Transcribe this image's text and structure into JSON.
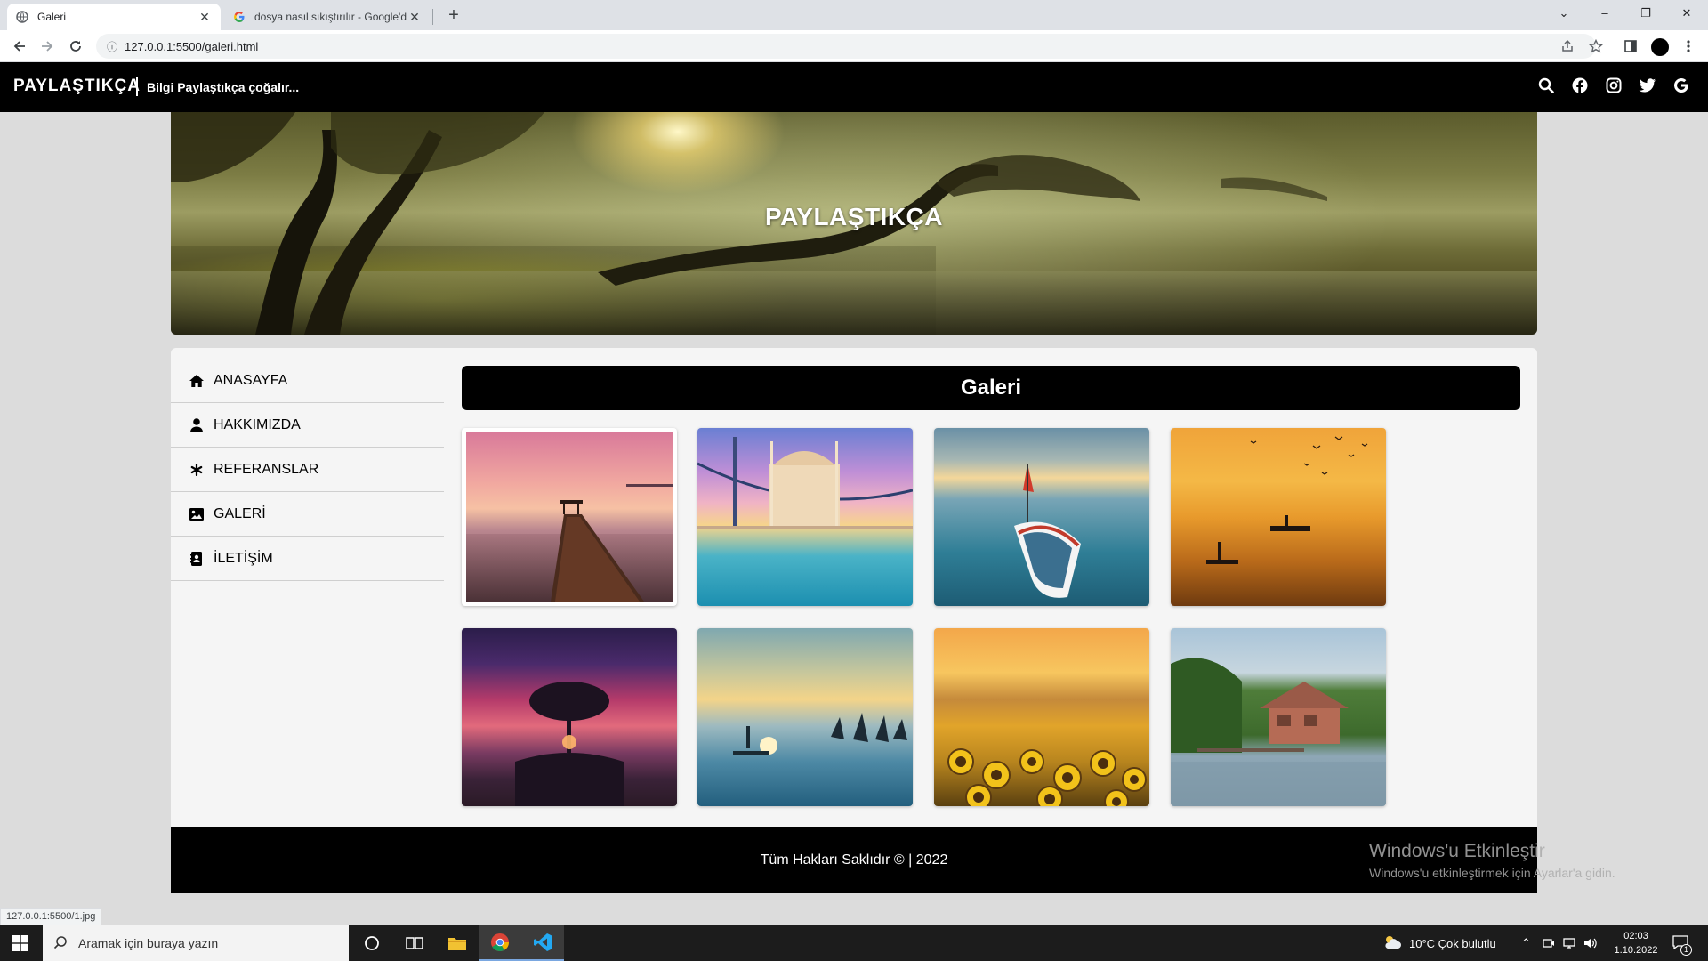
{
  "browser": {
    "tabs": [
      {
        "title": "Galeri",
        "active": true
      },
      {
        "title": "dosya nasıl sıkıştırılır - Google'da",
        "active": false
      }
    ],
    "url": "127.0.0.1:5500/galeri.html",
    "status_url": "127.0.0.1:5500/1.jpg"
  },
  "site": {
    "brand": "PAYLAŞTIKÇA",
    "tagline": "Bilgi Paylaştıkça çoğalır...",
    "hero_title": "PAYLAŞTIKÇA",
    "social_icons": [
      "search-icon",
      "facebook-icon",
      "instagram-icon",
      "twitter-icon",
      "google-icon"
    ],
    "menu": [
      {
        "label": "ANASAYFA",
        "icon": "home-icon"
      },
      {
        "label": "HAKKIMIZDA",
        "icon": "user-icon"
      },
      {
        "label": "REFERANSLAR",
        "icon": "asterisk-icon"
      },
      {
        "label": "GALERİ",
        "icon": "image-icon"
      },
      {
        "label": "İLETİŞİM",
        "icon": "contact-card-icon"
      }
    ],
    "gallery_title": "Galeri",
    "gallery_images": [
      "pier-sunset-image",
      "mosque-bridge-image",
      "boat-sea-image",
      "fisherman-sunset-image",
      "lone-tree-sunset-image",
      "paddleboard-sunset-image",
      "sunflower-field-image",
      "lake-house-image"
    ],
    "footer": "Tüm Hakları Saklıdır © | 2022",
    "watermark_title": "Windows'u Etkinleştir",
    "watermark_sub": "Windows'u etkinleştirmek için Ayarlar'a gidin."
  },
  "taskbar": {
    "search_placeholder": "Aramak için buraya yazın",
    "weather": "10°C  Çok bulutlu",
    "time": "02:03",
    "date": "1.10.2022",
    "notification_count": "1"
  },
  "colors": {
    "site_bar": "#000000",
    "page_bg": "#dcdcdc",
    "content_bg": "#f5f5f5"
  }
}
